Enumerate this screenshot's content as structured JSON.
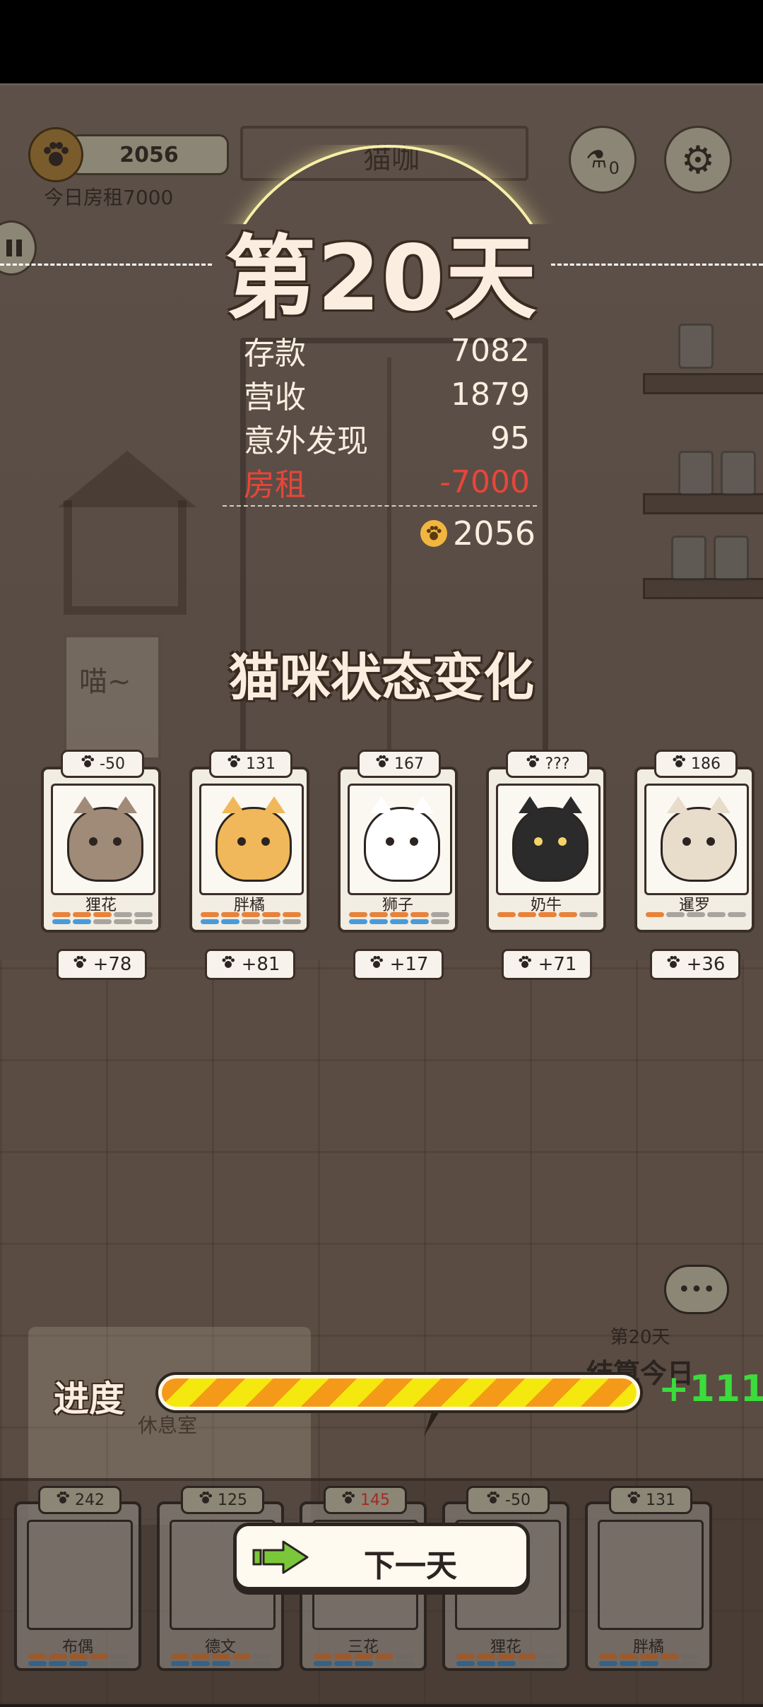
{
  "hud": {
    "coins": "2056",
    "rent_today": "今日房租7000",
    "potion_count": "0",
    "sign_text": "猫咖"
  },
  "day": {
    "title": "第20天"
  },
  "stats": [
    {
      "label": "存款",
      "value": "7082",
      "highlight": false
    },
    {
      "label": "营收",
      "value": "1879",
      "highlight": false
    },
    {
      "label": "意外发现",
      "value": "95",
      "highlight": false
    },
    {
      "label": "房租",
      "value": "-7000",
      "highlight": true
    }
  ],
  "total": "2056",
  "section_title": "猫咪状态变化",
  "cats": [
    {
      "name": "狸花",
      "score": "-50",
      "reward": "+78",
      "fur": "#a08a78",
      "bars": [
        [
          "o",
          "o",
          "o",
          "g",
          "g"
        ],
        [
          "b",
          "b",
          "g",
          "g",
          "g"
        ]
      ]
    },
    {
      "name": "胖橘",
      "score": "131",
      "reward": "+81",
      "fur": "#f0b85a",
      "bars": [
        [
          "o",
          "o",
          "o",
          "o",
          "o"
        ],
        [
          "b",
          "b",
          "g",
          "g",
          "g"
        ]
      ]
    },
    {
      "name": "狮子",
      "score": "167",
      "reward": "+17",
      "fur": "#ffffff",
      "bars": [
        [
          "o",
          "o",
          "o",
          "o",
          "g"
        ],
        [
          "b",
          "b",
          "b",
          "b",
          "g"
        ]
      ]
    },
    {
      "name": "奶牛",
      "score": "???",
      "reward": "+71",
      "fur": "#2b2b2b",
      "bars": [
        [
          "o",
          "o",
          "o",
          "o",
          "g"
        ]
      ]
    },
    {
      "name": "暹罗",
      "score": "186",
      "reward": "+36",
      "fur": "#e8dccb",
      "bars": [
        [
          "o",
          "g",
          "g",
          "g",
          "g"
        ]
      ]
    }
  ],
  "progress": {
    "label": "进度",
    "gain": "+111",
    "fraction": 1.0
  },
  "settle": {
    "day": "第20天",
    "text": "结算今日"
  },
  "rest_room": "休息室",
  "dock_cats": [
    {
      "name": "布偶",
      "score": "242",
      "red": false
    },
    {
      "name": "德文",
      "score": "125",
      "red": false
    },
    {
      "name": "三花",
      "score": "145",
      "red": true
    },
    {
      "name": "狸花",
      "score": "-50",
      "red": false
    },
    {
      "name": "胖橘",
      "score": "131",
      "red": false
    }
  ],
  "next_button": "下一天",
  "poster_text": "喵~",
  "colors": {
    "accent_red": "#e8453a",
    "progress_gain": "#3cdc3c",
    "card_bg": "#f2ede3"
  },
  "icons": [
    "paw-icon",
    "potion-icon",
    "gear-icon",
    "pause-icon",
    "arrow-right-icon",
    "chat-bubble-icon"
  ]
}
